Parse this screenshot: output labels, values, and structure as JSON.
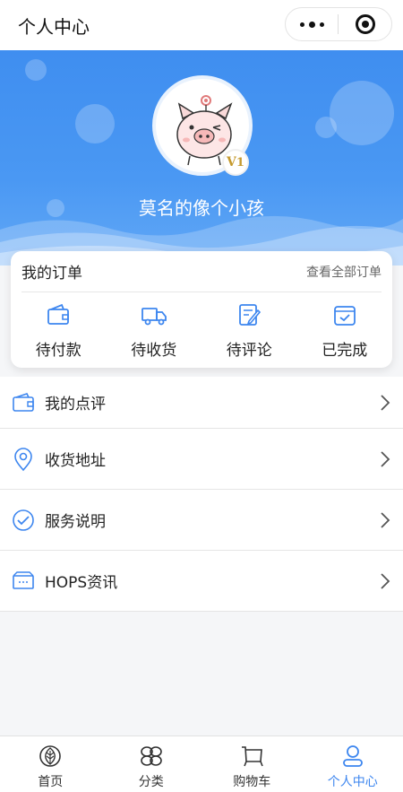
{
  "topbar": {
    "title": "个人中心"
  },
  "profile": {
    "nickname": "莫名的像个小孩",
    "vip_badge": "1"
  },
  "orders": {
    "title": "我的订单",
    "view_all": "查看全部订单",
    "items": [
      {
        "label": "待付款",
        "icon": "wallet-icon"
      },
      {
        "label": "待收货",
        "icon": "truck-icon"
      },
      {
        "label": "待评论",
        "icon": "edit-note-icon"
      },
      {
        "label": "已完成",
        "icon": "check-calendar-icon"
      }
    ]
  },
  "menu": [
    {
      "label": "我的点评",
      "icon": "wallet-icon"
    },
    {
      "label": "收货地址",
      "icon": "location-pin-icon"
    },
    {
      "label": "服务说明",
      "icon": "check-circle-icon"
    },
    {
      "label": "HOPS资讯",
      "icon": "news-box-icon"
    }
  ],
  "tabs": [
    {
      "label": "首页",
      "icon": "leaf-icon"
    },
    {
      "label": "分类",
      "icon": "category-icon"
    },
    {
      "label": "购物车",
      "icon": "cart-icon"
    },
    {
      "label": "个人中心",
      "icon": "user-icon",
      "active": true
    }
  ],
  "colors": {
    "accent": "#3d86ef",
    "header": "#4a98f3"
  }
}
